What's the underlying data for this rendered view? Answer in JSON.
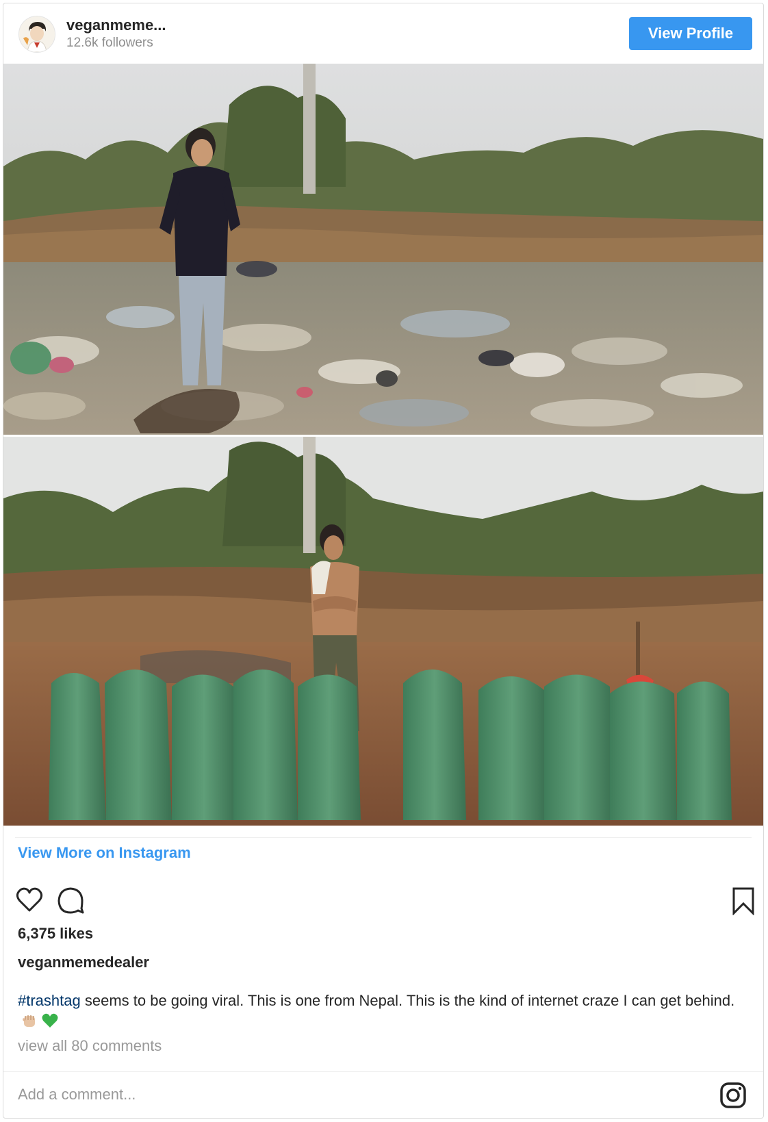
{
  "header": {
    "username": "veganmeme...",
    "followers": "12.6k followers",
    "view_profile_label": "View Profile"
  },
  "photo": {
    "panels": [
      "top-before-cleanup",
      "bottom-after-cleanup"
    ]
  },
  "links": {
    "view_more": "View More on Instagram"
  },
  "actions": {
    "icons": [
      "heart-icon",
      "comment-icon",
      "bookmark-icon"
    ]
  },
  "post": {
    "likes": "6,375 likes",
    "owner": "veganmemedealer",
    "hashtag": "#trashtag",
    "caption_text": " seems to be going viral. This is one from Nepal. This is the kind of internet craze I can get behind.",
    "emojis": [
      "raised-fist-emoji",
      "green-heart-emoji"
    ],
    "view_comments": "view all 80 comments"
  },
  "comment": {
    "placeholder": "Add a comment..."
  },
  "colors": {
    "accent": "#3897f0",
    "hashtag": "#003569",
    "muted": "#999999",
    "border": "#dbdbdb"
  }
}
